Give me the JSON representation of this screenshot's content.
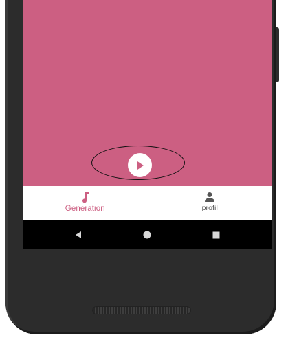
{
  "colors": {
    "accent": "#cc5f82",
    "content_background": "#cc5f82",
    "nav_background": "#ffffff",
    "inactive": "#555555",
    "system_bar": "#000000",
    "device_body": "#2c2c2c"
  },
  "player": {
    "play_icon": "play-icon"
  },
  "bottom_nav": {
    "items": [
      {
        "label": "Generation",
        "icon": "music-note-icon",
        "active": true
      },
      {
        "label": "profil",
        "icon": "person-icon",
        "active": false
      }
    ]
  },
  "system_nav": {
    "buttons": [
      {
        "icon": "back-triangle-icon"
      },
      {
        "icon": "home-circle-icon"
      },
      {
        "icon": "recents-square-icon"
      }
    ]
  }
}
